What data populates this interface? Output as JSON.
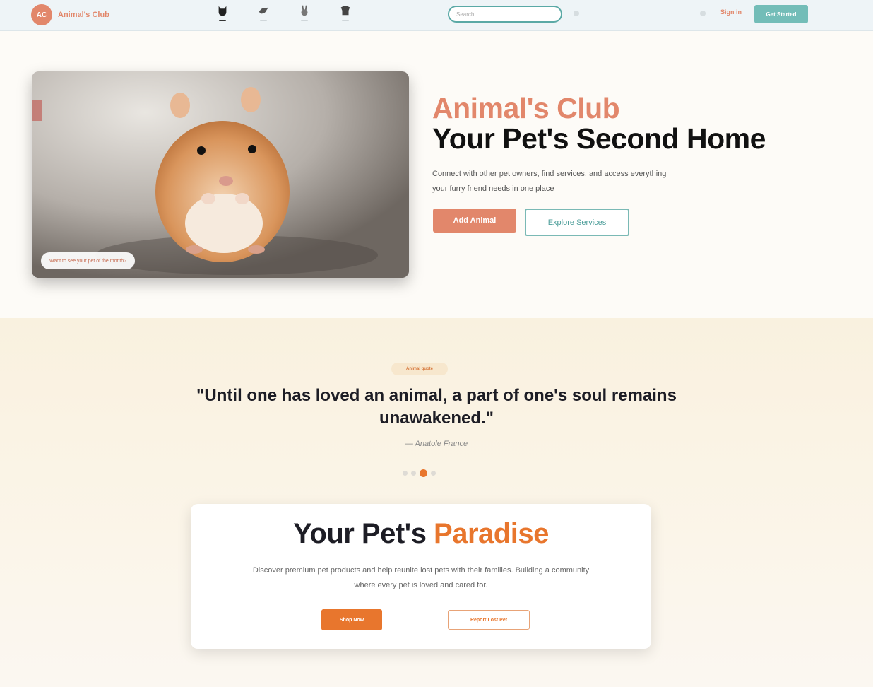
{
  "navbar": {
    "logo_badge": "AC",
    "logo_text": "Animal's Club",
    "nav_icons": [
      "cat-icon",
      "bird-icon",
      "rabbit-icon",
      "dog-icon"
    ],
    "search_placeholder": "Search...",
    "signin_label": "Sign in",
    "get_started_label": "Get Started"
  },
  "hero": {
    "image_caption": "Want to see your pet of the month?",
    "title": "Animal's Club",
    "subtitle": "Your Pet's Second Home",
    "description": "Connect with other pet owners, find services, and access everything your furry friend needs in one place",
    "add_animal_label": "Add Animal",
    "explore_label": "Explore Services"
  },
  "quote": {
    "tag": "Animal quote",
    "text": "\"Until one has loved an animal, a part of one's soul remains unawakened.\"",
    "author": "— Anatole France",
    "dots_count": 4,
    "active_dot": 2
  },
  "paradise": {
    "title_main": "Your Pet's ",
    "title_accent": "Paradise",
    "description": "Discover premium pet products and help reunite lost pets with their families. Building a community where every pet is loved and cared for.",
    "shop_label": "Shop Now",
    "report_label": "Report Lost Pet"
  },
  "colors": {
    "brand_salmon": "#e2876b",
    "teal": "#73bdb8",
    "orange": "#e8762d"
  }
}
